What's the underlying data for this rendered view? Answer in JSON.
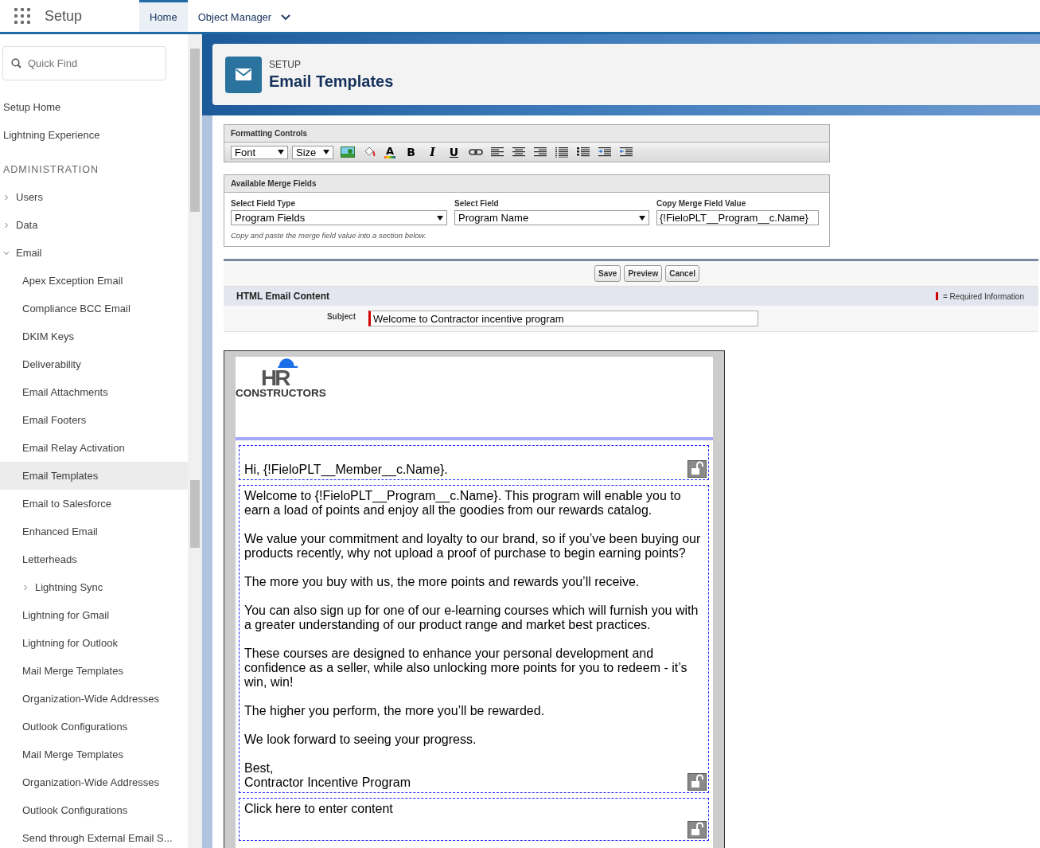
{
  "nav": {
    "app_name": "Setup",
    "tabs": [
      {
        "label": "Home",
        "selected": true
      },
      {
        "label": "Object Manager",
        "selected": false
      }
    ]
  },
  "sidebar": {
    "search": {
      "placeholder": "Quick Find"
    },
    "items": [
      {
        "kind": "link",
        "label": "Setup Home"
      },
      {
        "kind": "link",
        "label": "Lightning Experience"
      },
      {
        "kind": "heading",
        "label": "ADMINISTRATION"
      },
      {
        "kind": "group",
        "label": "Users",
        "expanded": false
      },
      {
        "kind": "group",
        "label": "Data",
        "expanded": false
      },
      {
        "kind": "group",
        "label": "Email",
        "expanded": true,
        "children": [
          {
            "kind": "link",
            "label": "Apex Exception Email",
            "selected": false
          },
          {
            "kind": "link",
            "label": "Compliance BCC Email",
            "selected": false
          },
          {
            "kind": "link",
            "label": "DKIM Keys",
            "selected": false
          },
          {
            "kind": "link",
            "label": "Deliverability",
            "selected": false
          },
          {
            "kind": "link",
            "label": "Email Attachments",
            "selected": false
          },
          {
            "kind": "link",
            "label": "Email Footers",
            "selected": false
          },
          {
            "kind": "link",
            "label": "Email Relay Activation",
            "selected": false
          },
          {
            "kind": "link",
            "label": "Email Templates",
            "selected": true
          },
          {
            "kind": "link",
            "label": "Email to Salesforce",
            "selected": false
          },
          {
            "kind": "link",
            "label": "Enhanced Email",
            "selected": false
          },
          {
            "kind": "link",
            "label": "Letterheads",
            "selected": false
          },
          {
            "kind": "group",
            "label": "Lightning Sync",
            "selected": false,
            "expanded": false
          },
          {
            "kind": "link",
            "label": "Lightning for Gmail",
            "selected": false
          },
          {
            "kind": "link",
            "label": "Lightning for Outlook",
            "selected": false
          },
          {
            "kind": "link",
            "label": "Mail Merge Templates",
            "selected": false
          },
          {
            "kind": "link",
            "label": "Organization-Wide Addresses",
            "selected": false
          },
          {
            "kind": "link",
            "label": "Outlook Configurations",
            "selected": false
          },
          {
            "kind": "link",
            "label": "Mail Merge Templates",
            "selected": false
          },
          {
            "kind": "link",
            "label": "Organization-Wide Addresses",
            "selected": false
          },
          {
            "kind": "link",
            "label": "Outlook Configurations",
            "selected": false
          },
          {
            "kind": "link",
            "label": "Send through External Email S...",
            "selected": false
          }
        ]
      }
    ]
  },
  "header": {
    "eyebrow": "SETUP",
    "title": "Email Templates"
  },
  "formatting": {
    "title": "Formatting Controls",
    "font_select": "Font",
    "size_select": "Size",
    "color_button": "A",
    "style_buttons": [
      {
        "kind": "bold",
        "text": "B"
      },
      {
        "kind": "italic",
        "text": "I"
      },
      {
        "kind": "underline",
        "text": "U"
      }
    ]
  },
  "merge_fields": {
    "title": "Available Merge Fields",
    "fields": [
      {
        "kind": "select",
        "label": "Select Field Type",
        "value": "Program Fields"
      },
      {
        "kind": "select",
        "label": "Select Field",
        "value": "Program Name"
      },
      {
        "kind": "input",
        "label": "Copy Merge Field Value",
        "value": "{!FieloPLT__Program__c.Name}"
      }
    ],
    "hint": "Copy and paste the merge field value into a section below."
  },
  "buttons": [
    "Save",
    "Preview",
    "Cancel"
  ],
  "content_section": {
    "title": "HTML Email Content",
    "required_legend": "= Required Information",
    "subject": {
      "label": "Subject",
      "value": "Welcome to Contractor incentive program"
    }
  },
  "template": {
    "logo_mark": "HR",
    "logo_text": "CONSTRUCTORS",
    "blocks": [
      {
        "paragraphs": [
          "Hi, {!FieloPLT__Member__c.Name}."
        ]
      },
      {
        "paragraphs": [
          "Welcome to {!FieloPLT__Program__c.Name}. This program will enable you to earn a load of points and enjoy all the goodies from our rewards catalog.",
          "We value your commitment and loyalty to our brand, so if you’ve been buying our products recently, why not upload a proof of purchase to begin earning points?",
          "The more you buy with us, the more points and rewards you’ll receive.",
          "You can also sign up for one of our e-learning courses which will furnish you with a greater understanding of our product range and market best practices.",
          "These courses are designed to enhance your personal development and confidence as a seller, while also unlocking more points for you to redeem - it’s win, win!",
          "The higher you perform, the more you’ll be rewarded.",
          "We look forward to seeing your progress.",
          "Best,\nContractor Incentive Program"
        ]
      },
      {
        "paragraphs": [
          "Click here to enter content"
        ]
      }
    ]
  }
}
